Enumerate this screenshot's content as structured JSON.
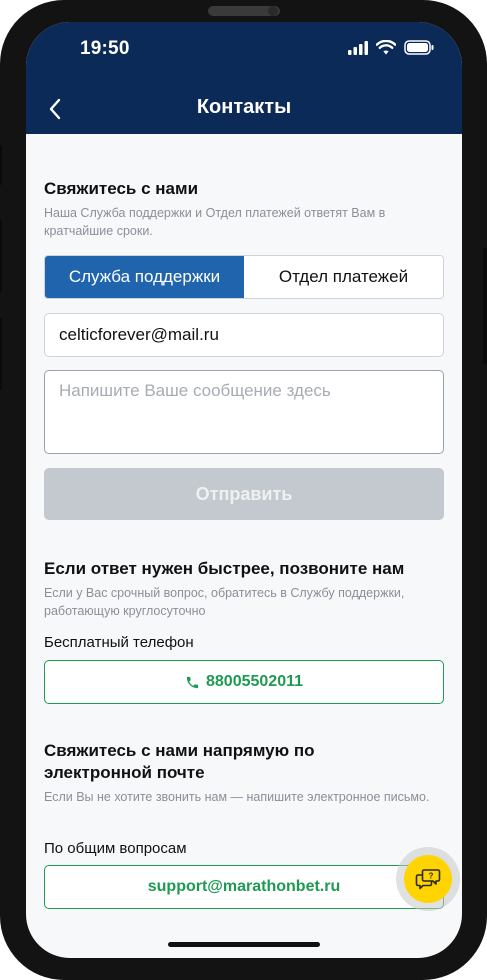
{
  "status_bar": {
    "time": "19:50"
  },
  "header": {
    "title": "Контакты"
  },
  "contact_form": {
    "title": "Свяжитесь с нами",
    "subtitle": "Наша Служба поддержки и Отдел платежей ответят Вам в кратчайшие сроки.",
    "tabs": [
      {
        "label": "Служба поддержки",
        "active": true
      },
      {
        "label": "Отдел платежей",
        "active": false
      }
    ],
    "email_value": "celticforever@mail.ru",
    "message_placeholder": "Напишите Ваше сообщение здесь",
    "send_label": "Отправить"
  },
  "call_section": {
    "title": "Если ответ нужен быстрее, позвоните нам",
    "subtitle": "Если у Вас срочный вопрос, обратитесь в Службу поддержки, работающую круглосуточно",
    "phone_label": "Бесплатный телефон",
    "phone_number": "88005502011"
  },
  "email_section": {
    "title": "Свяжитесь с нами напрямую по электронной почте",
    "subtitle": "Если Вы не хотите звонить нам — напишите электронное письмо.",
    "general_label": "По общим вопросам",
    "general_email": "support@marathonbet.ru"
  },
  "colors": {
    "header_bg": "#0b2a57",
    "tab_active": "#1f64ad",
    "accent_green": "#1f9a52",
    "chat_button": "#ffd400",
    "disabled_button": "#c4c9cf"
  },
  "icons": {
    "back": "chevron-left-icon",
    "phone": "phone-icon",
    "chat": "chat-help-icon",
    "signal": "signal-icon",
    "wifi": "wifi-icon",
    "battery": "battery-icon"
  }
}
